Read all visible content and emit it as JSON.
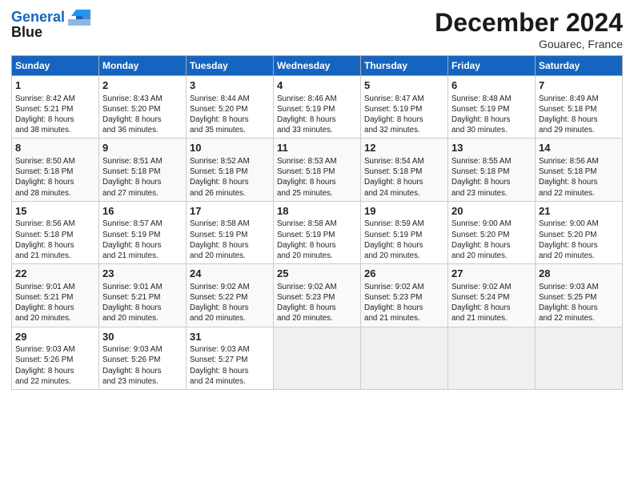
{
  "header": {
    "logo_line1": "General",
    "logo_line2": "Blue",
    "month": "December 2024",
    "location": "Gouarec, France"
  },
  "weekdays": [
    "Sunday",
    "Monday",
    "Tuesday",
    "Wednesday",
    "Thursday",
    "Friday",
    "Saturday"
  ],
  "weeks": [
    [
      {
        "day": "1",
        "info": "Sunrise: 8:42 AM\nSunset: 5:21 PM\nDaylight: 8 hours\nand 38 minutes."
      },
      {
        "day": "2",
        "info": "Sunrise: 8:43 AM\nSunset: 5:20 PM\nDaylight: 8 hours\nand 36 minutes."
      },
      {
        "day": "3",
        "info": "Sunrise: 8:44 AM\nSunset: 5:20 PM\nDaylight: 8 hours\nand 35 minutes."
      },
      {
        "day": "4",
        "info": "Sunrise: 8:46 AM\nSunset: 5:19 PM\nDaylight: 8 hours\nand 33 minutes."
      },
      {
        "day": "5",
        "info": "Sunrise: 8:47 AM\nSunset: 5:19 PM\nDaylight: 8 hours\nand 32 minutes."
      },
      {
        "day": "6",
        "info": "Sunrise: 8:48 AM\nSunset: 5:19 PM\nDaylight: 8 hours\nand 30 minutes."
      },
      {
        "day": "7",
        "info": "Sunrise: 8:49 AM\nSunset: 5:18 PM\nDaylight: 8 hours\nand 29 minutes."
      }
    ],
    [
      {
        "day": "8",
        "info": "Sunrise: 8:50 AM\nSunset: 5:18 PM\nDaylight: 8 hours\nand 28 minutes."
      },
      {
        "day": "9",
        "info": "Sunrise: 8:51 AM\nSunset: 5:18 PM\nDaylight: 8 hours\nand 27 minutes."
      },
      {
        "day": "10",
        "info": "Sunrise: 8:52 AM\nSunset: 5:18 PM\nDaylight: 8 hours\nand 26 minutes."
      },
      {
        "day": "11",
        "info": "Sunrise: 8:53 AM\nSunset: 5:18 PM\nDaylight: 8 hours\nand 25 minutes."
      },
      {
        "day": "12",
        "info": "Sunrise: 8:54 AM\nSunset: 5:18 PM\nDaylight: 8 hours\nand 24 minutes."
      },
      {
        "day": "13",
        "info": "Sunrise: 8:55 AM\nSunset: 5:18 PM\nDaylight: 8 hours\nand 23 minutes."
      },
      {
        "day": "14",
        "info": "Sunrise: 8:56 AM\nSunset: 5:18 PM\nDaylight: 8 hours\nand 22 minutes."
      }
    ],
    [
      {
        "day": "15",
        "info": "Sunrise: 8:56 AM\nSunset: 5:18 PM\nDaylight: 8 hours\nand 21 minutes."
      },
      {
        "day": "16",
        "info": "Sunrise: 8:57 AM\nSunset: 5:19 PM\nDaylight: 8 hours\nand 21 minutes."
      },
      {
        "day": "17",
        "info": "Sunrise: 8:58 AM\nSunset: 5:19 PM\nDaylight: 8 hours\nand 20 minutes."
      },
      {
        "day": "18",
        "info": "Sunrise: 8:58 AM\nSunset: 5:19 PM\nDaylight: 8 hours\nand 20 minutes."
      },
      {
        "day": "19",
        "info": "Sunrise: 8:59 AM\nSunset: 5:19 PM\nDaylight: 8 hours\nand 20 minutes."
      },
      {
        "day": "20",
        "info": "Sunrise: 9:00 AM\nSunset: 5:20 PM\nDaylight: 8 hours\nand 20 minutes."
      },
      {
        "day": "21",
        "info": "Sunrise: 9:00 AM\nSunset: 5:20 PM\nDaylight: 8 hours\nand 20 minutes."
      }
    ],
    [
      {
        "day": "22",
        "info": "Sunrise: 9:01 AM\nSunset: 5:21 PM\nDaylight: 8 hours\nand 20 minutes."
      },
      {
        "day": "23",
        "info": "Sunrise: 9:01 AM\nSunset: 5:21 PM\nDaylight: 8 hours\nand 20 minutes."
      },
      {
        "day": "24",
        "info": "Sunrise: 9:02 AM\nSunset: 5:22 PM\nDaylight: 8 hours\nand 20 minutes."
      },
      {
        "day": "25",
        "info": "Sunrise: 9:02 AM\nSunset: 5:23 PM\nDaylight: 8 hours\nand 20 minutes."
      },
      {
        "day": "26",
        "info": "Sunrise: 9:02 AM\nSunset: 5:23 PM\nDaylight: 8 hours\nand 21 minutes."
      },
      {
        "day": "27",
        "info": "Sunrise: 9:02 AM\nSunset: 5:24 PM\nDaylight: 8 hours\nand 21 minutes."
      },
      {
        "day": "28",
        "info": "Sunrise: 9:03 AM\nSunset: 5:25 PM\nDaylight: 8 hours\nand 22 minutes."
      }
    ],
    [
      {
        "day": "29",
        "info": "Sunrise: 9:03 AM\nSunset: 5:26 PM\nDaylight: 8 hours\nand 22 minutes."
      },
      {
        "day": "30",
        "info": "Sunrise: 9:03 AM\nSunset: 5:26 PM\nDaylight: 8 hours\nand 23 minutes."
      },
      {
        "day": "31",
        "info": "Sunrise: 9:03 AM\nSunset: 5:27 PM\nDaylight: 8 hours\nand 24 minutes."
      },
      null,
      null,
      null,
      null
    ]
  ]
}
